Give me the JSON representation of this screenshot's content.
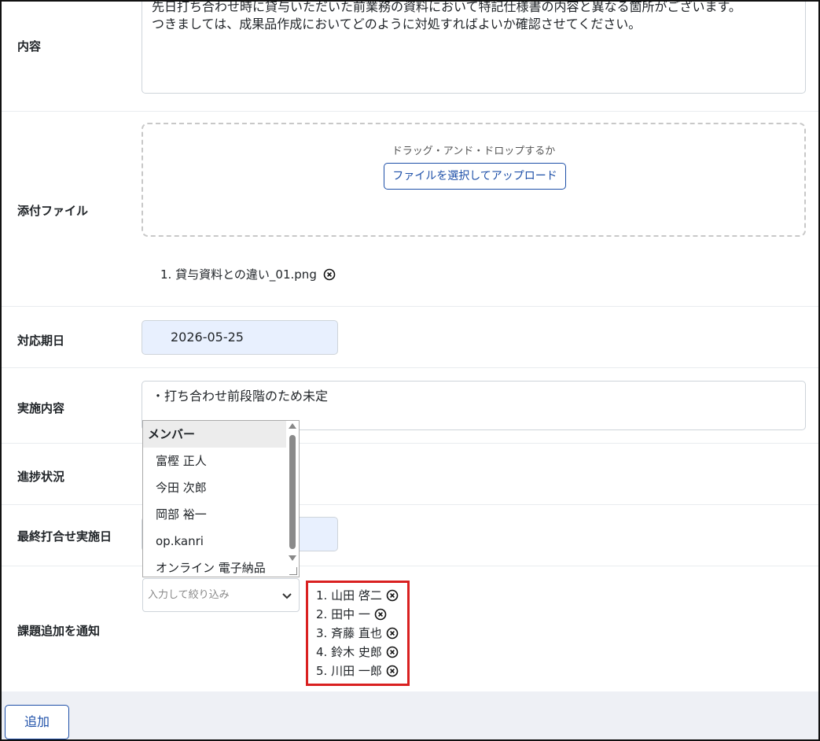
{
  "form": {
    "content": {
      "label": "内容",
      "lines": [
        "先日打ち合わせ時に貸与いただいた前業務の資料において特記仕様書の内容と異なる箇所がございます。",
        "つきましては、成果品作成においてどのように対処すればよいか確認させてください。"
      ]
    },
    "attachment": {
      "label": "添付ファイル",
      "drop_text": "ドラッグ・アンド・ドロップするか",
      "select_button": "ファイルを選択してアップロード",
      "files": [
        "1. 貸与資料との違い_01.png"
      ]
    },
    "due_date": {
      "label": "対応期日",
      "value": "2026-05-25"
    },
    "action": {
      "label": "実施内容",
      "value": "・打ち合わせ前段階のため未定"
    },
    "progress": {
      "label": "進捗状況"
    },
    "last_meeting": {
      "label": "最終打合せ実施日"
    },
    "notify": {
      "label": "課題追加を通知",
      "filter_placeholder": "入力して絞り込み",
      "dropdown": {
        "group_label": "メンバー",
        "options": [
          "富樫 正人",
          "今田 次郎",
          "岡部 裕一",
          "op.kanri",
          "オンライン 電子納品"
        ]
      },
      "selected": [
        "1. 山田 啓二",
        "2. 田中 一",
        "3. 斉藤 直也",
        "4. 鈴木 史郎",
        "5. 川田 一郎"
      ]
    }
  },
  "footer": {
    "add_button": "追加"
  },
  "colors": {
    "accent": "#1d4fa8",
    "highlight_border": "#d92020",
    "date_bg": "#e8f0fe"
  },
  "icons": {
    "remove": "circle-x-icon",
    "dropdown": "chevron-down-icon"
  }
}
